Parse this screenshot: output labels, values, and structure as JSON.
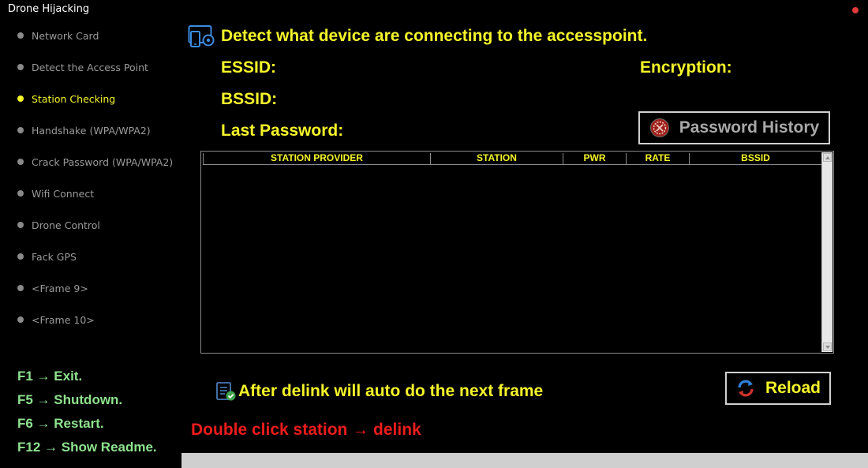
{
  "app": {
    "title": "Drone Hijacking"
  },
  "sidebar": {
    "items": [
      {
        "label": "Network Card",
        "active": false
      },
      {
        "label": "Detect the Access Point",
        "active": false
      },
      {
        "label": "Station Checking",
        "active": true
      },
      {
        "label": "Handshake (WPA/WPA2)",
        "active": false
      },
      {
        "label": "Crack Password (WPA/WPA2)",
        "active": false
      },
      {
        "label": "Wifi Connect",
        "active": false
      },
      {
        "label": "Drone Control",
        "active": false
      },
      {
        "label": "Fack GPS",
        "active": false
      },
      {
        "label": "<Frame 9>",
        "active": false
      },
      {
        "label": "<Frame 10>",
        "active": false
      }
    ]
  },
  "shortcuts": [
    "F1 → Exit.",
    "F5 → Shutdown.",
    "F6 → Restart.",
    "F12 → Show Readme."
  ],
  "main": {
    "heading": "Detect what device are connecting to the accesspoint.",
    "heading_icon": "device-settings-icon",
    "essid_label": "ESSID:",
    "encryption_label": "Encryption:",
    "bssid_label": "BSSID:",
    "last_password_label": "Last Password:",
    "password_history_button": "Password History",
    "password_history_icon": "history-icon",
    "table": {
      "columns": [
        "STATION PROVIDER",
        "STATION",
        "PWR",
        "RATE",
        "BSSID"
      ],
      "rows": []
    },
    "note": "After delink will auto do the next frame",
    "note_icon": "checklist-icon",
    "reload_button": "Reload",
    "reload_icon": "refresh-icon",
    "delink_hint": "Double click station → delink"
  },
  "colors": {
    "accent_yellow": "#f5f52a",
    "shortcut_green": "#8ee28e",
    "warning_red": "#ec1c1c",
    "inactive_gray": "#9a9a9a",
    "close_dot": "#e03a3a"
  }
}
